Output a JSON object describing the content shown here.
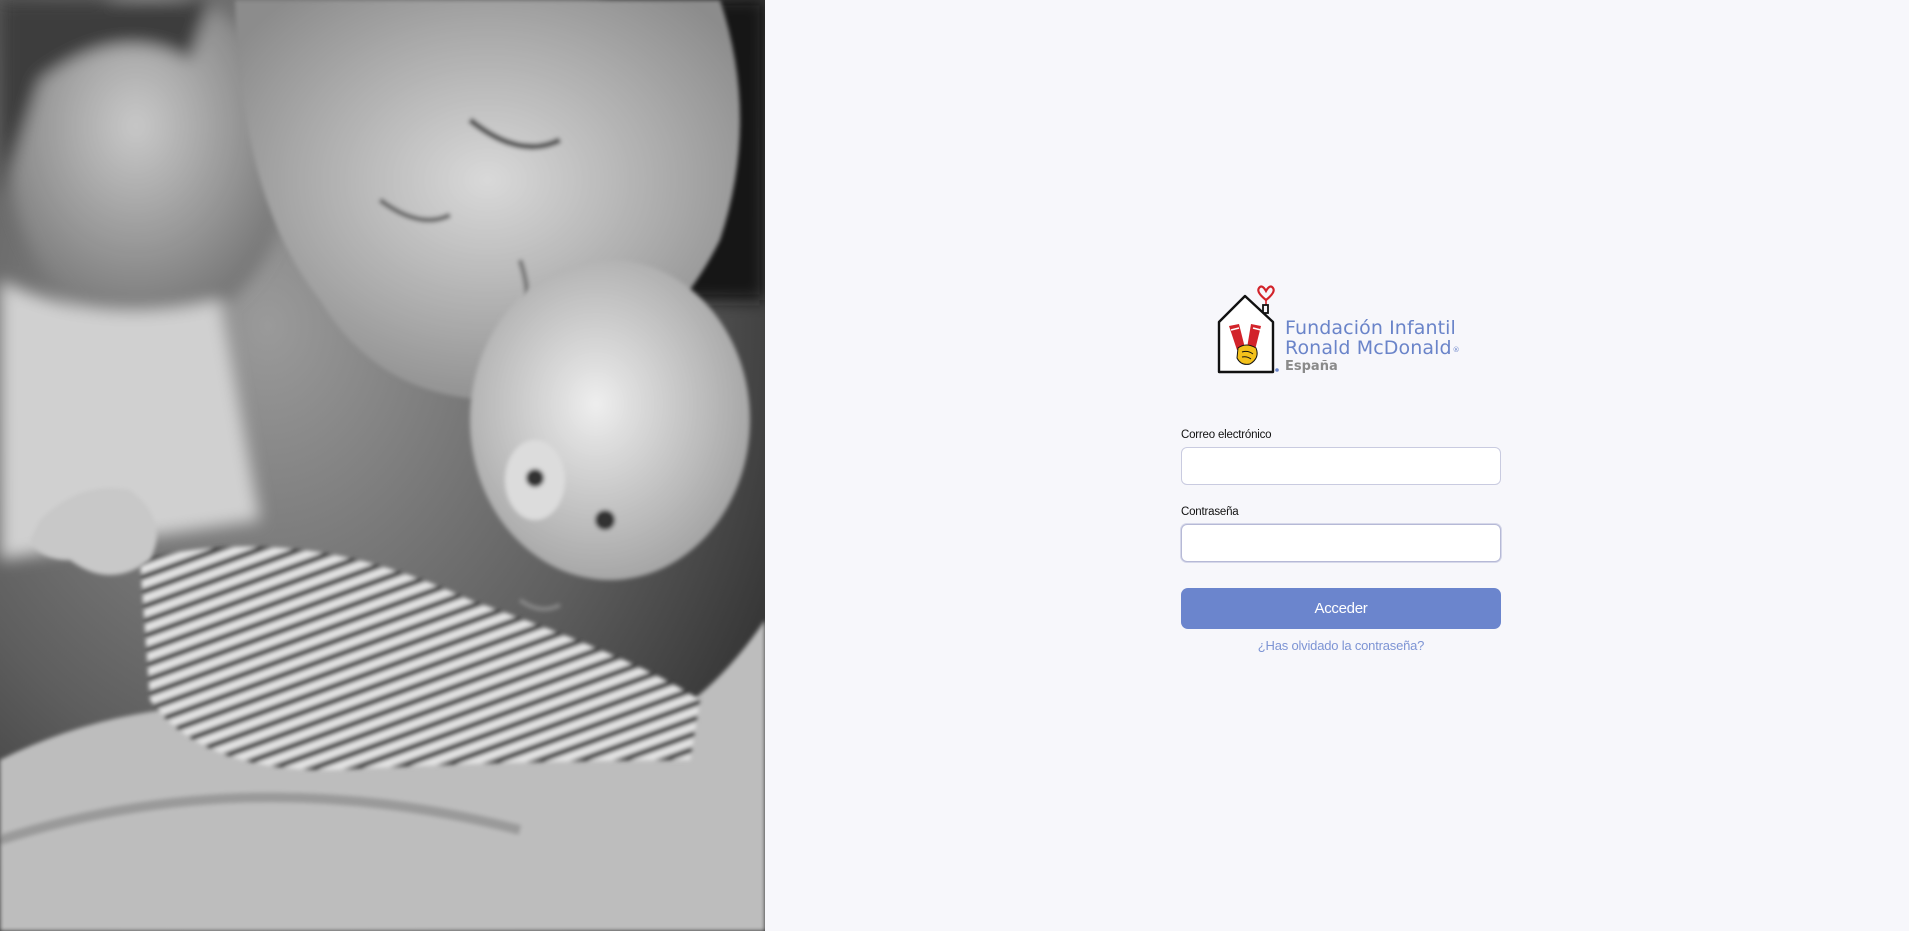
{
  "photo": {
    "alt": ""
  },
  "logo": {
    "line1": "Fundación Infantil",
    "line2": "Ronald McDonald",
    "line3": "España",
    "reg_mark": "®"
  },
  "form": {
    "email_label": "Correo electrónico",
    "email_value": "",
    "email_placeholder": "",
    "password_label": "Contraseña",
    "password_value": "",
    "password_placeholder": "",
    "submit_label": "Acceder",
    "forgot_label": "¿Has olvidado la contraseña?"
  },
  "colors": {
    "brand_blue": "#6b85cd",
    "link_blue": "#7d94d4",
    "logo_text_blue": "#6a84c9",
    "logo_red": "#d2232a",
    "logo_yellow": "#f3c11b",
    "page_background": "#f7f7fb"
  }
}
